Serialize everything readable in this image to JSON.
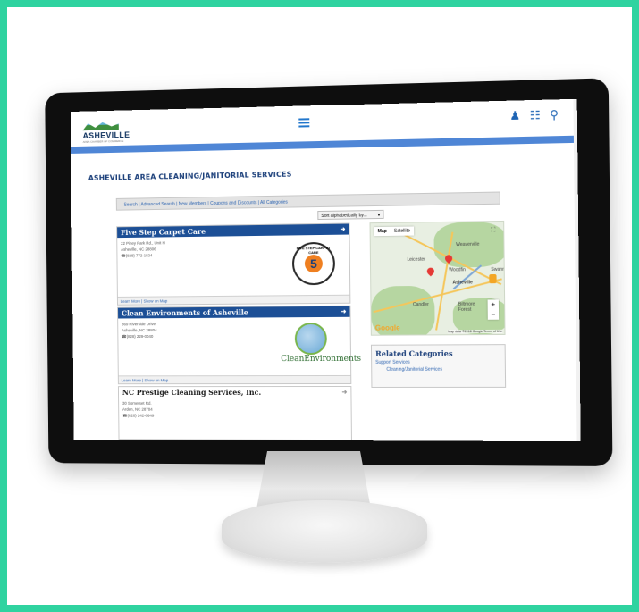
{
  "site": {
    "logo_text": "ASHEVILLE",
    "logo_sub": "AREA CHAMBER OF COMMERCE"
  },
  "header_icons": [
    "person-icon",
    "book-icon",
    "search-icon"
  ],
  "page": {
    "title": "ASHEVILLE AREA CLEANING/JANITORIAL SERVICES"
  },
  "nav": {
    "links": "Search | Advanced Search | New Members | Coupons and Discounts | All Categories"
  },
  "sort": {
    "label": "Sort alphabetically by..."
  },
  "listings": [
    {
      "name": "Five Step Carpet Care",
      "address1": "22 Piney Park Rd., Unit H",
      "address2": "Asheville, NC 28806",
      "phone": "(828) 772-1824",
      "footer": "Learn More | Show on Map",
      "logo_ring": "FIVE STEP CARPET CARE",
      "logo_number": "5"
    },
    {
      "name": "Clean Environments of Asheville",
      "address1": "869 Riverside Drive",
      "address2": "Asheville, NC 28804",
      "phone": "(828) 229-0040",
      "footer": "Learn More | Show on Map",
      "logo_text": "CleanEnvironments"
    },
    {
      "name": "NC Prestige Cleaning Services, Inc.",
      "address1": "30 Somerset Rd.",
      "address2": "Arden, NC 28704",
      "phone": "(828) 242-6649"
    }
  ],
  "map": {
    "tab_map": "Map",
    "tab_satellite": "Satellite",
    "labels": {
      "weaverville": "Weaverville",
      "leicester": "Leicester",
      "asheville": "Asheville",
      "woodfin": "Woodfin",
      "candler": "Candler",
      "biltmore": "Biltmore Forest",
      "swannanoa": "Swann"
    },
    "credit": "Map data ©2018 Google  Terms of Use",
    "google": "Google"
  },
  "related": {
    "heading": "Related Categories",
    "parent": "Support Services",
    "child": "Cleaning/Janitorial Services"
  }
}
